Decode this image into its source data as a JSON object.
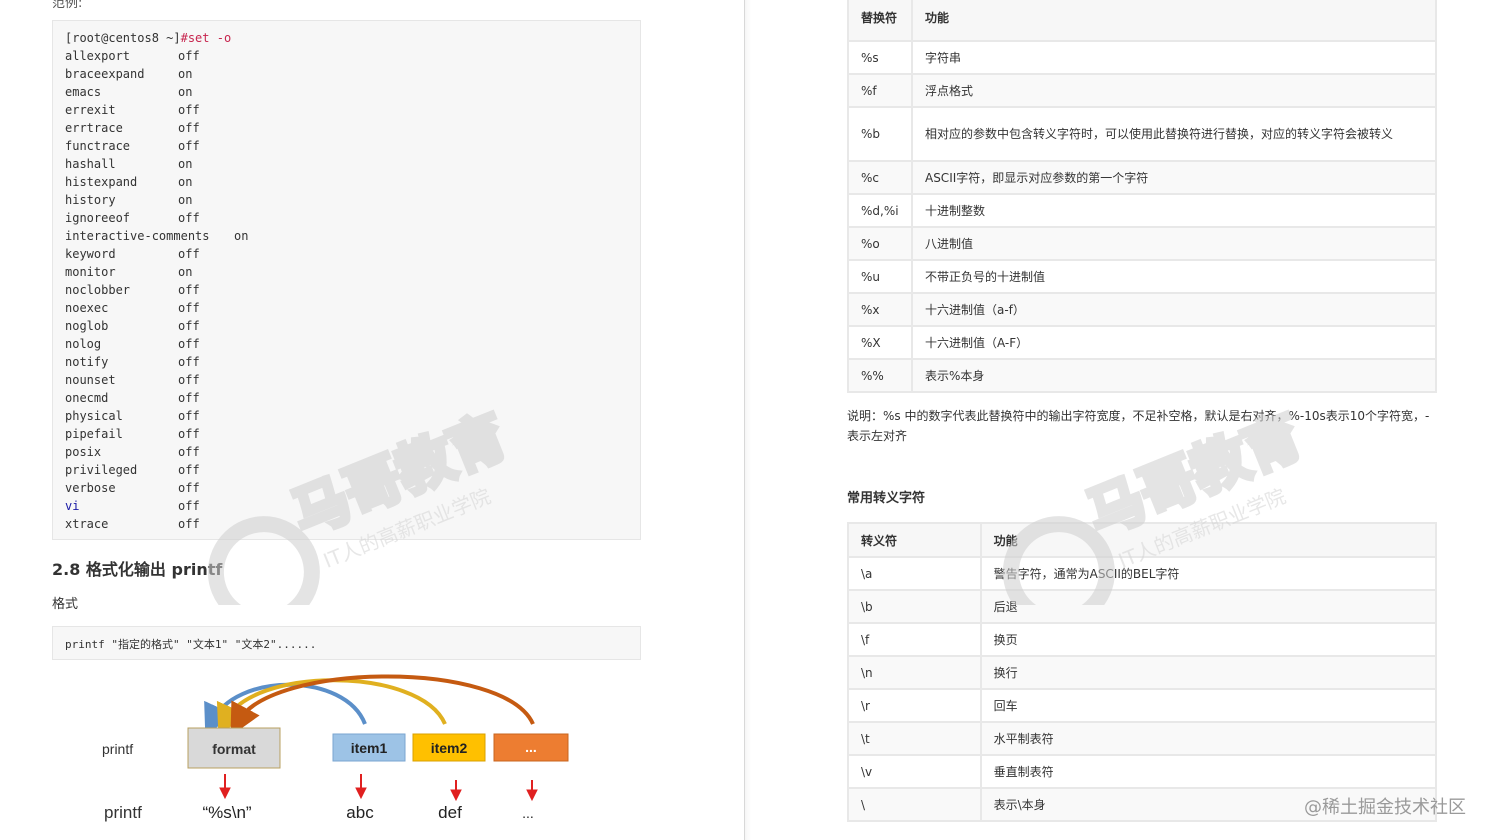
{
  "left": {
    "top_cut_text": "范例:",
    "terminal": {
      "prompt": "[root@centos8 ~]",
      "command": "#set -o",
      "options": [
        {
          "name": "allexport",
          "value": "off"
        },
        {
          "name": "braceexpand",
          "value": "on"
        },
        {
          "name": "emacs",
          "value": "on"
        },
        {
          "name": "errexit",
          "value": "off"
        },
        {
          "name": "errtrace",
          "value": "off"
        },
        {
          "name": "functrace",
          "value": "off"
        },
        {
          "name": "hashall",
          "value": "on"
        },
        {
          "name": "histexpand",
          "value": "on"
        },
        {
          "name": "history",
          "value": "on"
        },
        {
          "name": "ignoreeof",
          "value": "off"
        },
        {
          "name": "interactive-comments",
          "value": "on"
        },
        {
          "name": "keyword",
          "value": "off"
        },
        {
          "name": "monitor",
          "value": "on"
        },
        {
          "name": "noclobber",
          "value": "off"
        },
        {
          "name": "noexec",
          "value": "off"
        },
        {
          "name": "noglob",
          "value": "off"
        },
        {
          "name": "nolog",
          "value": "off"
        },
        {
          "name": "notify",
          "value": "off"
        },
        {
          "name": "nounset",
          "value": "off"
        },
        {
          "name": "onecmd",
          "value": "off"
        },
        {
          "name": "physical",
          "value": "off"
        },
        {
          "name": "pipefail",
          "value": "off"
        },
        {
          "name": "posix",
          "value": "off"
        },
        {
          "name": "privileged",
          "value": "off"
        },
        {
          "name": "verbose",
          "value": "off"
        },
        {
          "name": "vi",
          "value": "off"
        },
        {
          "name": "xtrace",
          "value": "off"
        }
      ]
    },
    "section_title": "2.8 格式化输出 printf",
    "format_label": "格式",
    "printf_syntax": "printf \"指定的格式\" \"文本1\" \"文本2\"......",
    "diagram": {
      "row1_label": "printf",
      "row2_label": "printf",
      "format_box": "format",
      "item1_box": "item1",
      "item2_box": "item2",
      "more_box": "...",
      "format_value": "“%s\\n”",
      "item1_value": "abc",
      "item2_value": "def",
      "more_value": "...",
      "colors": {
        "format_fill": "#d9d9d9",
        "item1_fill": "#9dc3e6",
        "item2_fill": "#ffc000",
        "more_fill": "#ed7d31",
        "arc_blue": "#5b8fc9",
        "arc_yellow": "#e0b020",
        "arc_orange": "#c55a11",
        "arrow_red": "#e02020"
      }
    }
  },
  "right": {
    "table1": {
      "headers": [
        "替换符",
        "功能"
      ],
      "rows": [
        [
          "%s",
          "字符串"
        ],
        [
          "%f",
          "浮点格式"
        ],
        [
          "%b",
          "相对应的参数中包含转义字符时，可以使用此替换符进行替换，对应的转义字符会被转义"
        ],
        [
          "%c",
          "ASCII字符，即显示对应参数的第一个字符"
        ],
        [
          "%d,%i",
          "十进制整数"
        ],
        [
          "%o",
          "八进制值"
        ],
        [
          "%u",
          "不带正负号的十进制值"
        ],
        [
          "%x",
          "十六进制值（a-f）"
        ],
        [
          "%X",
          "十六进制值（A-F）"
        ],
        [
          "%%",
          "表示%本身"
        ]
      ]
    },
    "note": "说明：%s 中的数字代表此替换符中的输出字符宽度，不足补空格，默认是右对齐，%-10s表示10个字符宽，- 表示左对齐",
    "subhead": "常用转义字符",
    "table2": {
      "headers": [
        "转义符",
        "功能"
      ],
      "rows": [
        [
          "\\a",
          "警告字符，通常为ASCII的BEL字符"
        ],
        [
          "\\b",
          "后退"
        ],
        [
          "\\f",
          "换页"
        ],
        [
          "\\n",
          "换行"
        ],
        [
          "\\r",
          "回车"
        ],
        [
          "\\t",
          "水平制表符"
        ],
        [
          "\\v",
          "垂直制表符"
        ],
        [
          "\\",
          "表示\\本身"
        ]
      ]
    }
  },
  "watermark": {
    "brand": "马哥教育",
    "slogan": "IT人的高薪职业学院",
    "corner": "@稀土掘金技术社区"
  }
}
